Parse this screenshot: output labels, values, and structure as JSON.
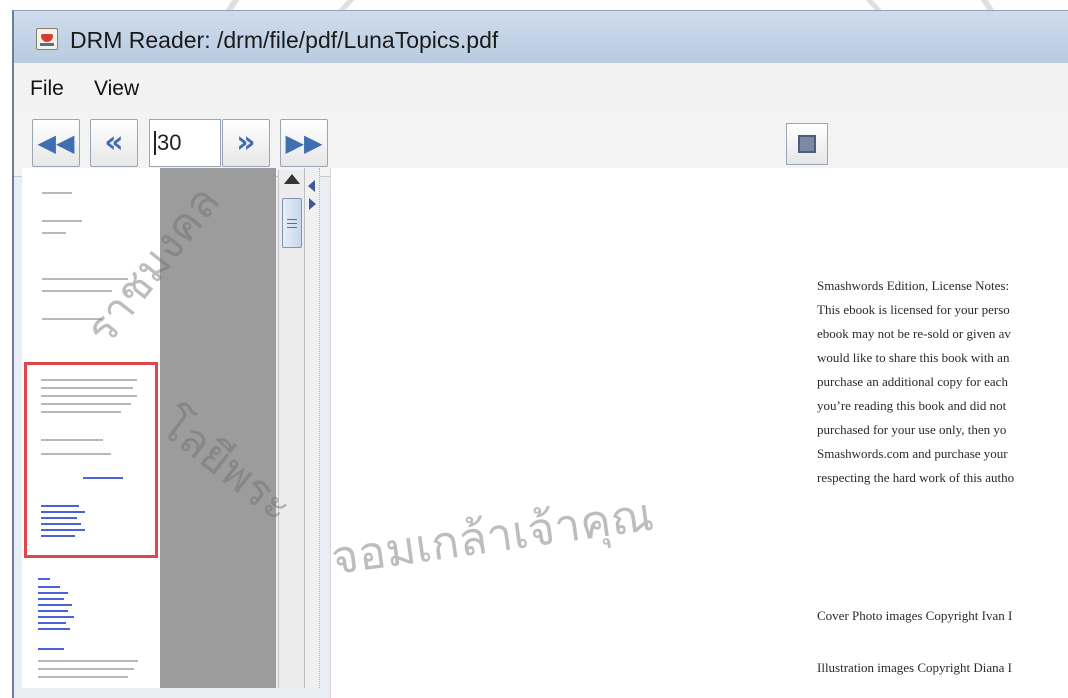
{
  "window": {
    "title": "DRM Reader: /drm/file/pdf/LunaTopics.pdf"
  },
  "menu": {
    "file": "File",
    "view": "View"
  },
  "toolbar": {
    "page_number": "30",
    "buttons": {
      "first": "first-page-icon",
      "prev": "previous-page-icon",
      "next": "next-page-icon",
      "last": "last-page-icon",
      "fit": "fit-page-icon"
    }
  },
  "thumbnails": {
    "selected_index": 1
  },
  "document": {
    "lines": [
      "Smashwords Edition, License Notes:",
      "This ebook is licensed for your perso",
      "ebook may not be re-sold or given av",
      "would like to share this book with an",
      "purchase an additional copy for each",
      "you’re reading this book and did not",
      "purchased for your use only, then yo",
      "Smashwords.com and purchase your",
      "respecting the hard work of this autho"
    ],
    "cover_credit": "Cover Photo images Copyright Ivan I",
    "illustration_credit": "Illustration images Copyright Diana I"
  },
  "watermark": {
    "text_left": "ราชมงคล",
    "text_bottom": "จอมเกล้าเจ้าคุณ",
    "text_left_lower": "โลยีพระ"
  }
}
